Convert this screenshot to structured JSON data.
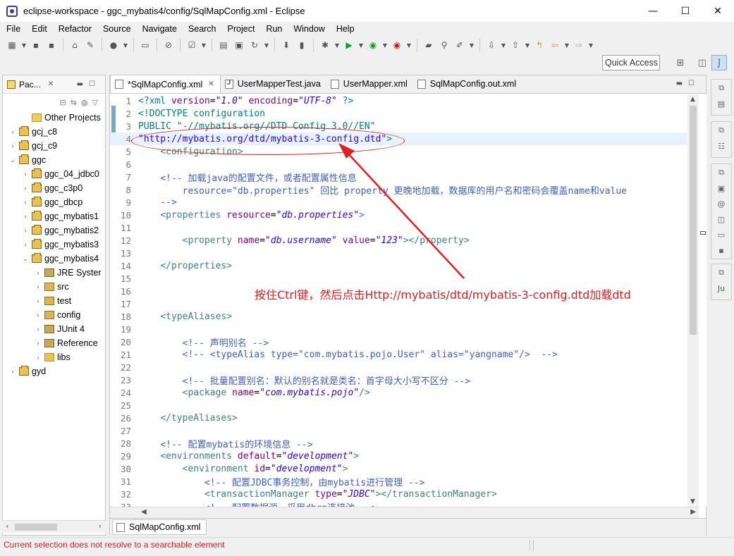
{
  "window": {
    "title": "eclipse-workspace - ggc_mybatis4/config/SqlMapConfig.xml - Eclipse",
    "minimize": "—",
    "maximize": "☐",
    "close": "✕"
  },
  "menu": [
    "File",
    "Edit",
    "Refactor",
    "Source",
    "Navigate",
    "Search",
    "Project",
    "Run",
    "Window",
    "Help"
  ],
  "toolbar": {
    "quick_access": "Quick Access"
  },
  "left_panel": {
    "tab_label": "Pac...",
    "tree": [
      {
        "label": "Other Projects",
        "depth": 1,
        "arrow": "",
        "icon": "other"
      },
      {
        "label": "gcj_c8",
        "depth": 0,
        "arrow": "›",
        "icon": "project"
      },
      {
        "label": "gcj_c9",
        "depth": 0,
        "arrow": "›",
        "icon": "project"
      },
      {
        "label": "ggc",
        "depth": 0,
        "arrow": "⌄",
        "icon": "project"
      },
      {
        "label": "ggc_04_jdbc0",
        "depth": 1,
        "arrow": "›",
        "icon": "project"
      },
      {
        "label": "ggc_c3p0",
        "depth": 1,
        "arrow": "›",
        "icon": "project"
      },
      {
        "label": "ggc_dbcp",
        "depth": 1,
        "arrow": "›",
        "icon": "project"
      },
      {
        "label": "ggc_mybatis1",
        "depth": 1,
        "arrow": "›",
        "icon": "project"
      },
      {
        "label": "ggc_mybatis2",
        "depth": 1,
        "arrow": "›",
        "icon": "project"
      },
      {
        "label": "ggc_mybatis3",
        "depth": 1,
        "arrow": "›",
        "icon": "project"
      },
      {
        "label": "ggc_mybatis4",
        "depth": 1,
        "arrow": "⌄",
        "icon": "project"
      },
      {
        "label": "JRE Syster",
        "depth": 2,
        "arrow": "›",
        "icon": "lib"
      },
      {
        "label": "src",
        "depth": 2,
        "arrow": "›",
        "icon": "pkg"
      },
      {
        "label": "test",
        "depth": 2,
        "arrow": "›",
        "icon": "pkg"
      },
      {
        "label": "config",
        "depth": 2,
        "arrow": "›",
        "icon": "pkg"
      },
      {
        "label": "JUnit 4",
        "depth": 2,
        "arrow": "›",
        "icon": "lib"
      },
      {
        "label": "Reference",
        "depth": 2,
        "arrow": "›",
        "icon": "lib"
      },
      {
        "label": "libs",
        "depth": 2,
        "arrow": "›",
        "icon": "folder"
      },
      {
        "label": "gyd",
        "depth": 0,
        "arrow": "›",
        "icon": "project"
      }
    ]
  },
  "editor": {
    "tabs": [
      {
        "label": "*SqlMapConfig.xml",
        "active": true,
        "kind": "xml"
      },
      {
        "label": "UserMapperTest.java",
        "active": false,
        "kind": "java"
      },
      {
        "label": "UserMapper.xml",
        "active": false,
        "kind": "xml"
      },
      {
        "label": "SqlMapConfig.out.xml",
        "active": false,
        "kind": "xml"
      }
    ],
    "current_line": 4,
    "bottom_tab": "SqlMapConfig.xml",
    "lines": [
      [
        [
          "pi",
          "<?xml "
        ],
        [
          "attr",
          "version"
        ],
        [
          "",
          "="
        ],
        [
          "val",
          "\"1.0\""
        ],
        [
          "attr",
          " encoding"
        ],
        [
          "",
          "="
        ],
        [
          "val",
          "\"UTF-8\""
        ],
        [
          "pi",
          " ?>"
        ]
      ],
      [
        [
          "doctype",
          "<!DOCTYPE configuration"
        ]
      ],
      [
        [
          "doctype",
          "PUBLIC \"-//mybatis.org//DTD Config 3.0//EN\""
        ]
      ],
      [
        [
          "str",
          "\"http://mybatis.org/dtd/mybatis-3-config.dtd\""
        ],
        [
          "doctype",
          ">"
        ]
      ],
      [
        [
          "",
          "    "
        ],
        [
          "tag",
          "<configuration>"
        ]
      ],
      [
        [
          "",
          ""
        ]
      ],
      [
        [
          "",
          "    "
        ],
        [
          "cmt",
          "<!-- 加载java的配置文件，或者配置属性信息"
        ]
      ],
      [
        [
          "",
          "        "
        ],
        [
          "cmt",
          "resource=\"db.properties\" 回比 property 更晚地加载，数据库的用户名和密码会覆盖name和value"
        ]
      ],
      [
        [
          "",
          "    "
        ],
        [
          "cmt",
          "-->"
        ]
      ],
      [
        [
          "",
          "    "
        ],
        [
          "tag",
          "<properties "
        ],
        [
          "attr",
          "resource"
        ],
        [
          "",
          "="
        ],
        [
          "val",
          "\"db.properties\""
        ],
        [
          "tag",
          ">"
        ]
      ],
      [
        [
          "",
          ""
        ]
      ],
      [
        [
          "",
          "        "
        ],
        [
          "tag",
          "<property "
        ],
        [
          "attr",
          "name"
        ],
        [
          "",
          "="
        ],
        [
          "val",
          "\"db.username\""
        ],
        [
          "attr",
          " value"
        ],
        [
          "",
          "="
        ],
        [
          "val",
          "\"123\""
        ],
        [
          "tag",
          "></property>"
        ]
      ],
      [
        [
          "",
          ""
        ]
      ],
      [
        [
          "",
          "    "
        ],
        [
          "tag",
          "</properties>"
        ]
      ],
      [
        [
          "",
          ""
        ]
      ],
      [
        [
          "",
          ""
        ]
      ],
      [
        [
          "",
          ""
        ]
      ],
      [
        [
          "",
          "    "
        ],
        [
          "tag",
          "<typeAliases>"
        ]
      ],
      [
        [
          "",
          ""
        ]
      ],
      [
        [
          "",
          "        "
        ],
        [
          "cmt",
          "<!-- 声明别名 -->"
        ]
      ],
      [
        [
          "",
          "        "
        ],
        [
          "cmt",
          "<!-- <typeAlias type=\"com.mybatis.pojo.User\" alias=\"yangname\"/>  -->"
        ]
      ],
      [
        [
          "",
          ""
        ]
      ],
      [
        [
          "",
          "        "
        ],
        [
          "cmt",
          "<!-- 批量配置别名：默认的别名就是类名：首字母大小写不区分 -->"
        ]
      ],
      [
        [
          "",
          "        "
        ],
        [
          "tag",
          "<package "
        ],
        [
          "attr",
          "name"
        ],
        [
          "",
          "="
        ],
        [
          "val",
          "\"com.mybatis.pojo\""
        ],
        [
          "tag",
          "/>"
        ]
      ],
      [
        [
          "",
          ""
        ]
      ],
      [
        [
          "",
          "    "
        ],
        [
          "tag",
          "</typeAliases>"
        ]
      ],
      [
        [
          "",
          ""
        ]
      ],
      [
        [
          "",
          "    "
        ],
        [
          "cmt",
          "<!-- 配置mybatis的环境信息 -->"
        ]
      ],
      [
        [
          "",
          "    "
        ],
        [
          "tag",
          "<environments "
        ],
        [
          "attr",
          "default"
        ],
        [
          "",
          "="
        ],
        [
          "val",
          "\"development\""
        ],
        [
          "tag",
          ">"
        ]
      ],
      [
        [
          "",
          "        "
        ],
        [
          "tag",
          "<environment "
        ],
        [
          "attr",
          "id"
        ],
        [
          "",
          "="
        ],
        [
          "val",
          "\"development\""
        ],
        [
          "tag",
          ">"
        ]
      ],
      [
        [
          "",
          "            "
        ],
        [
          "cmt",
          "<!-- 配置JDBC事务控制，由mybatis进行管理 -->"
        ]
      ],
      [
        [
          "",
          "            "
        ],
        [
          "tag",
          "<transactionManager "
        ],
        [
          "attr",
          "type"
        ],
        [
          "",
          "="
        ],
        [
          "val",
          "\"JDBC\""
        ],
        [
          "tag",
          "></transactionManager>"
        ]
      ],
      [
        [
          "",
          "            "
        ],
        [
          "cmt",
          "<!-- 配置数据源，采用dbcp连接池 -->"
        ]
      ]
    ]
  },
  "annotation": {
    "text": "按住Ctrl键，然后点击Http://mybatis/dtd/mybatis-3-config.dtd加载dtd",
    "color": "#e02020"
  },
  "status": {
    "message": "Current selection does not resolve to a searchable element"
  }
}
